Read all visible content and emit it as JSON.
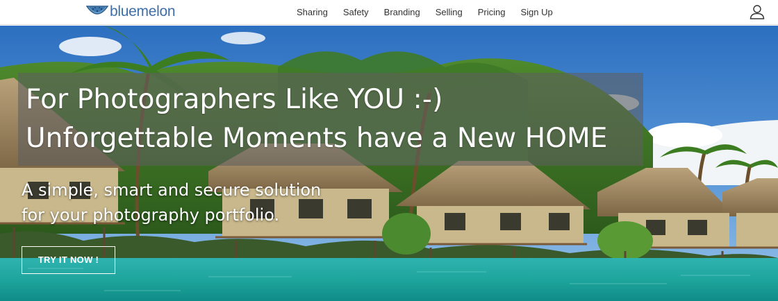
{
  "brand": {
    "name": "bluemelon"
  },
  "nav": {
    "items": [
      {
        "label": "Sharing"
      },
      {
        "label": "Safety"
      },
      {
        "label": "Branding"
      },
      {
        "label": "Selling"
      },
      {
        "label": "Pricing"
      },
      {
        "label": "Sign Up"
      }
    ],
    "user_icon": "user-icon"
  },
  "hero": {
    "headline_line1": "For Photographers Like YOU :-)",
    "headline_line2": "Unforgettable Moments have a New HOME",
    "sub_line1": "A simple, smart and secure solution",
    "sub_line2": "for your photography portfolio.",
    "cta_label": "TRY IT NOW !",
    "image_description_icon": "tropical-bungalows-image"
  },
  "colors": {
    "brand_blue": "#3e6fa8",
    "headline_box": "#5f5f5f",
    "nav_text": "#333333"
  }
}
